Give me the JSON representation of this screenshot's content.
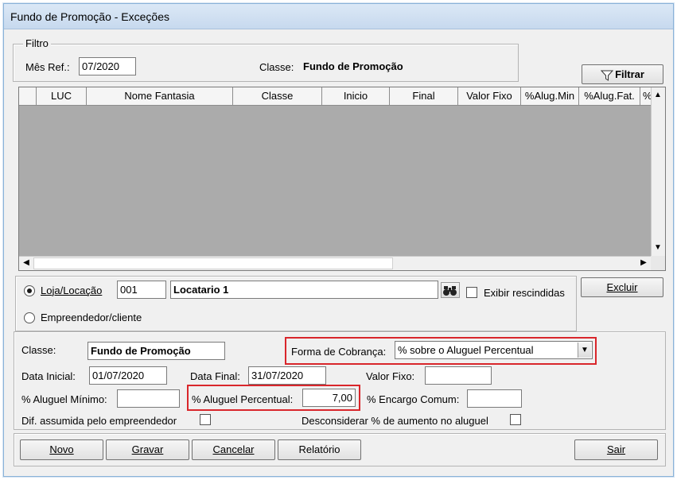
{
  "window": {
    "title": "Fundo de Promoção - Exceções"
  },
  "filter": {
    "legend": "Filtro",
    "mes_ref_label": "Mês Ref.:",
    "mes_ref_value": "07/2020",
    "classe_label": "Classe:",
    "classe_value": "Fundo de Promoção",
    "filter_button": "Filtrar"
  },
  "grid": {
    "columns": [
      "LUC",
      "Nome Fantasia",
      "Classe",
      "Inicio",
      "Final",
      "Valor Fixo",
      "%Alug.Min",
      "%Alug.Fat.",
      "%"
    ],
    "rows": []
  },
  "selection": {
    "loja_radio_label": "Loja/Locação",
    "loja_code": "001",
    "loja_name": "Locatario 1",
    "exibir_rescindidas_label": "Exibir rescindidas",
    "empreendedor_radio_label": "Empreendedor/cliente",
    "excluir_button": "Excluir"
  },
  "detail": {
    "classe_label": "Classe:",
    "classe_value": "Fundo de Promoção",
    "forma_cobranca_label": "Forma de Cobrança:",
    "forma_cobranca_value": "% sobre o Aluguel Percentual",
    "data_inicial_label": "Data Inicial:",
    "data_inicial_value": "01/07/2020",
    "data_final_label": "Data Final:",
    "data_final_value": "31/07/2020",
    "valor_fixo_label": "Valor Fixo:",
    "valor_fixo_value": "",
    "aluguel_minimo_label": "% Aluguel Mínimo:",
    "aluguel_minimo_value": "",
    "aluguel_percentual_label": "% Aluguel Percentual:",
    "aluguel_percentual_value": "7,00",
    "encargo_comum_label": "% Encargo Comum:",
    "encargo_comum_value": "",
    "dif_assumida_label": "Dif. assumida pelo empreendedor",
    "desconsiderar_label": "Desconsiderar % de aumento no aluguel"
  },
  "footer": {
    "novo": "Novo",
    "gravar": "Gravar",
    "cancelar": "Cancelar",
    "relatorio": "Relatório",
    "sair": "Sair"
  },
  "colors": {
    "highlight": "#d9262b",
    "grid_bg": "#ababab"
  }
}
